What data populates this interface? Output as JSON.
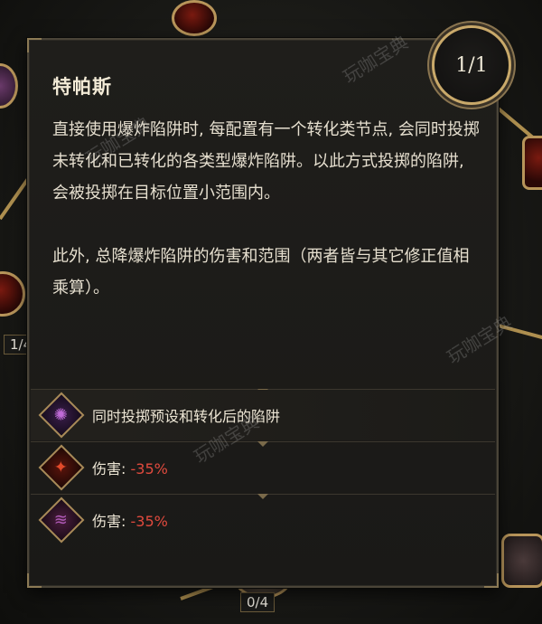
{
  "skill": {
    "name": "特帕斯",
    "level": "1/1",
    "description": [
      "直接使用爆炸陷阱时, 每配置有一个转化类节点, 会同时投掷未转化和已转化的各类型爆炸陷阱。以此方式投掷的陷阱, 会被投掷在目标位置小范围内。",
      "此外, 总降爆炸陷阱的伤害和范围（两者皆与其它修正值相乘算）。"
    ]
  },
  "modifiers": [
    {
      "icon": "trap-swirl-icon",
      "glyph": "✺",
      "icon_color": "#c06bd8",
      "label": "同时投掷预设和转化后的陷阱",
      "value": ""
    },
    {
      "icon": "damage-flame-icon",
      "glyph": "✦",
      "icon_color": "#e24a2a",
      "label": "伤害: ",
      "value": "-35%"
    },
    {
      "icon": "area-wave-icon",
      "glyph": "≋",
      "icon_color": "#b05ab8",
      "label": "伤害: ",
      "value": "-35%"
    }
  ],
  "background": {
    "counter_left": "1/4",
    "counter_bottom": "0/4"
  },
  "watermark": "玩咖宝典",
  "colors": {
    "accent_gold": "#c9a96a",
    "negative": "#e04a3e",
    "text": "#e6dfcf"
  }
}
